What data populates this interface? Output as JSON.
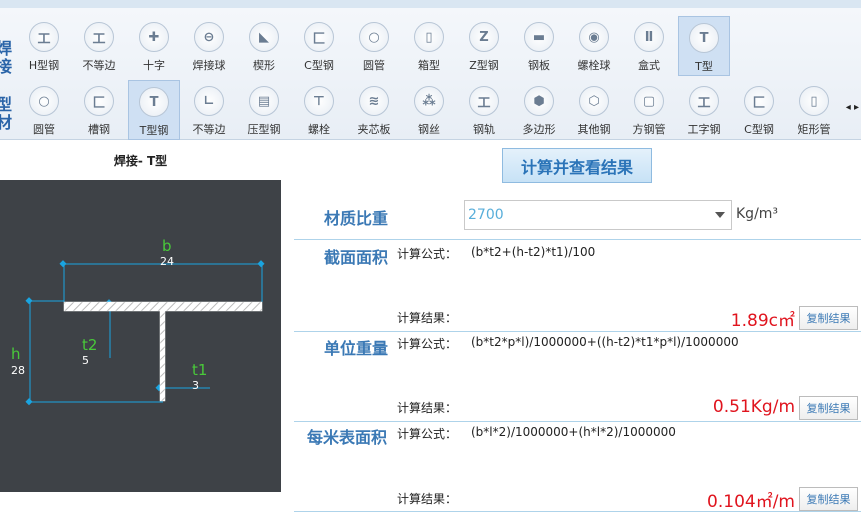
{
  "toolbar": {
    "row1_label": "焊接",
    "row2_label": "型材",
    "row1": [
      {
        "label": "H型钢",
        "glyph": "工"
      },
      {
        "label": "不等边",
        "glyph": "工"
      },
      {
        "label": "十字",
        "glyph": "✚"
      },
      {
        "label": "焊接球",
        "glyph": "⊖"
      },
      {
        "label": "楔形",
        "glyph": "◣"
      },
      {
        "label": "C型钢",
        "glyph": "匚"
      },
      {
        "label": "圆管",
        "glyph": "○"
      },
      {
        "label": "箱型",
        "glyph": "▯"
      },
      {
        "label": "Z型钢",
        "glyph": "Z"
      },
      {
        "label": "钢板",
        "glyph": "▬"
      },
      {
        "label": "螺栓球",
        "glyph": "◉"
      },
      {
        "label": "盒式",
        "glyph": "Ⅱ"
      },
      {
        "label": "T型",
        "glyph": "T"
      }
    ],
    "row2": [
      {
        "label": "圆管",
        "glyph": "○"
      },
      {
        "label": "槽钢",
        "glyph": "匚"
      },
      {
        "label": "T型钢",
        "glyph": "T"
      },
      {
        "label": "不等边",
        "glyph": "∟"
      },
      {
        "label": "压型钢",
        "glyph": "▤"
      },
      {
        "label": "螺栓",
        "glyph": "⊤"
      },
      {
        "label": "夹芯板",
        "glyph": "≋"
      },
      {
        "label": "钢丝",
        "glyph": "⁂"
      },
      {
        "label": "钢轨",
        "glyph": "工"
      },
      {
        "label": "多边形",
        "glyph": "⬢"
      },
      {
        "label": "其他钢",
        "glyph": "⬡"
      },
      {
        "label": "方钢管",
        "glyph": "▢"
      },
      {
        "label": "工字钢",
        "glyph": "工"
      },
      {
        "label": "C型钢",
        "glyph": "匚"
      },
      {
        "label": "矩形管",
        "glyph": "▯"
      }
    ],
    "selected_row1": 12,
    "selected_row2": 2,
    "scroll_arrows": "◂ ▸"
  },
  "drawing": {
    "title": "焊接- T型",
    "b_label": "b",
    "b_value": "24",
    "h_label": "h",
    "h_value": "28",
    "t2_label": "t2",
    "t2_value": "5",
    "t1_label": "t1",
    "t1_value": "3",
    "bg_color": "#3e4247",
    "dim_color": "#49c93a"
  },
  "calc": {
    "button_label": "计算并查看结果",
    "density_label": "材质比重",
    "density_value": "2700",
    "density_unit": "Kg/m³",
    "formula_prefix": "计算公式：",
    "result_prefix": "计算结果：",
    "copy_label": "复制结果",
    "sections": [
      {
        "title": "截面面积",
        "formula": "(b*t2+(h-t2)*t1)/100",
        "result": "1.89c㎡"
      },
      {
        "title": "单位重量",
        "formula": "(b*t2*p*l)/1000000+((h-t2)*t1*p*l)/1000000",
        "result": "0.51Kg/m"
      },
      {
        "title": "每米表面积",
        "formula": "(b*l*2)/1000000+(h*l*2)/1000000",
        "result": "0.104㎡/m"
      }
    ],
    "accent": "#3b79b5",
    "result_color": "#e0141e"
  }
}
